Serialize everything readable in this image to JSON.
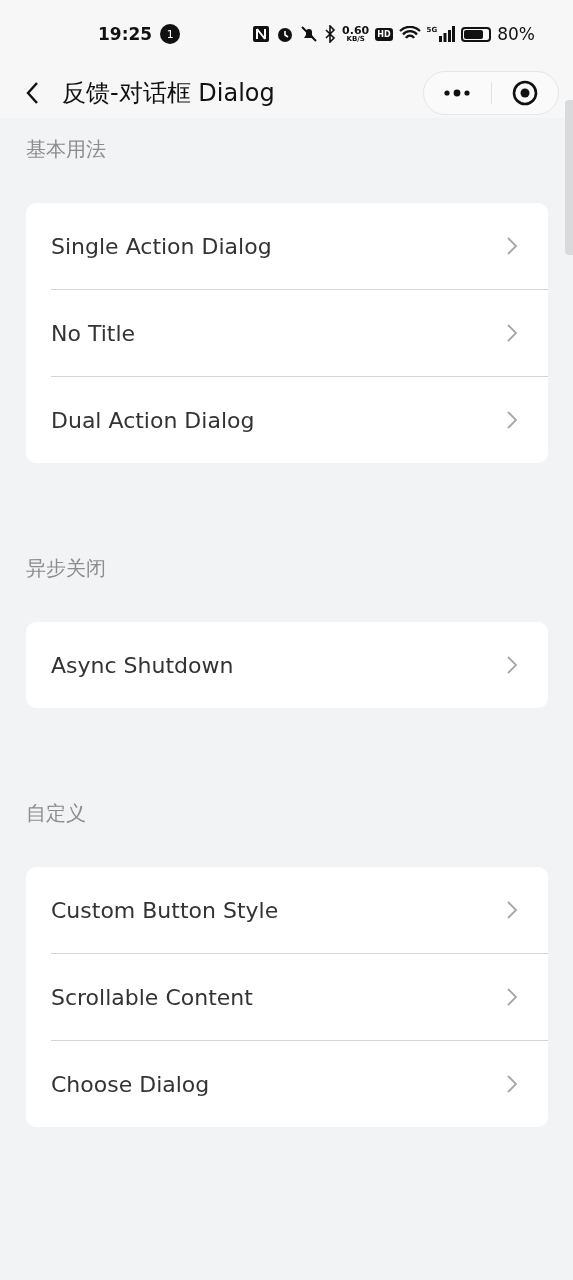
{
  "status_bar": {
    "time": "19:25",
    "notification_count": "1",
    "network_speed": "0.60",
    "network_unit": "KB/S",
    "hd": "HD",
    "network_type": "5G",
    "battery": "80%"
  },
  "nav_bar": {
    "title": "反馈-对话框 Dialog"
  },
  "sections": [
    {
      "title": "基本用法",
      "items": [
        {
          "label": "Single Action Dialog"
        },
        {
          "label": "No Title"
        },
        {
          "label": "Dual Action Dialog"
        }
      ]
    },
    {
      "title": "异步关闭",
      "items": [
        {
          "label": "Async Shutdown"
        }
      ]
    },
    {
      "title": "自定义",
      "items": [
        {
          "label": "Custom Button Style"
        },
        {
          "label": "Scrollable Content"
        },
        {
          "label": "Choose Dialog"
        }
      ]
    }
  ]
}
